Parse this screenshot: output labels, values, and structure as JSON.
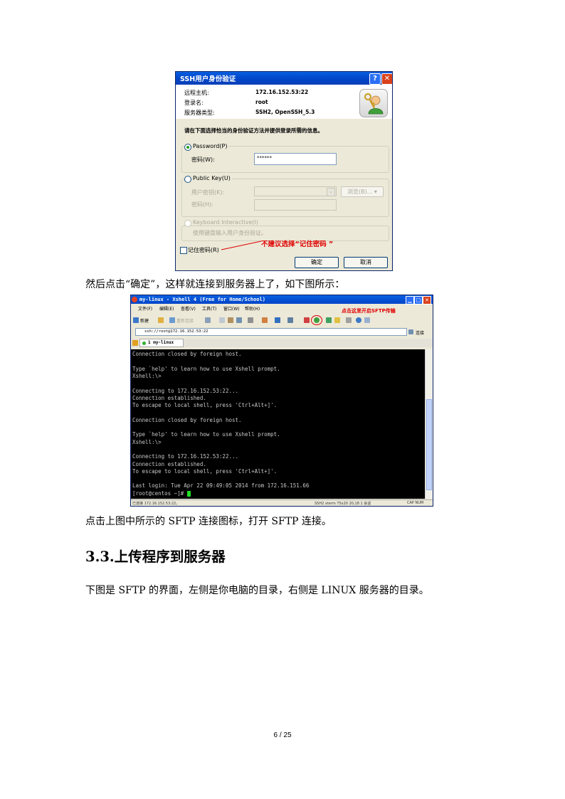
{
  "dialog": {
    "title": "SSH用户身份验证",
    "help": "?",
    "close": "✕",
    "info": [
      {
        "label": "远程主机:",
        "value": "172.16.152.53:22"
      },
      {
        "label": "登录名:",
        "value": "root"
      },
      {
        "label": "服务器类型:",
        "value": "SSH2, OpenSSH_5.3"
      }
    ],
    "instruction": "请在下面选择恰当的身份验证方法并提供登录所需的信息。",
    "password_option": "Password(P)",
    "password_label": "密码(W):",
    "password_value": "******",
    "publickey_option": "Public Key(U)",
    "user_key_label": "用户密钥(K):",
    "browse_button": "浏览(B)... ▾",
    "passphrase_label": "密码(H):",
    "keyboard_option": "Keyboard Interactive(I)",
    "keyboard_desc": "使用键盘输入用户身份验证。",
    "remember_password": "记住密码(R)",
    "annotation": "不建议选择“记住密码 ”",
    "ok_button": "确定",
    "cancel_button": "取消"
  },
  "para1": "然后点击“确定”，这样就连接到服务器上了，如下图所示：",
  "xshell": {
    "title": "my-linux - Xshell 4 (Free for Home/School)",
    "menu": [
      "文件(F)",
      "编辑(E)",
      "查看(V)",
      "工具(T)",
      "窗口(W)",
      "帮助(H)"
    ],
    "new_button": "新建",
    "reconnect": "重新连接",
    "address": "ssh://root@172.16.152.53:22",
    "connect_button": "连接",
    "annotation": "点击这里开启SFTP传输",
    "tab": "1 my-linux",
    "terminal_lines": [
      "Connection closed by foreign host.",
      "",
      "Type `help' to learn how to use Xshell prompt.",
      "Xshell:\\>",
      "",
      "Connecting to 172.16.152.53:22...",
      "Connection established.",
      "To escape to local shell, press 'Ctrl+Alt+]'.",
      "",
      "Connection closed by foreign host.",
      "",
      "Type `help' to learn how to use Xshell prompt.",
      "Xshell:\\>",
      "",
      "Connecting to 172.16.152.53:22...",
      "Connection established.",
      "To escape to local shell, press 'Ctrl+Alt+]'.",
      "",
      "Last login: Tue Apr 22 09:49:05 2014 from 172.16.151.66",
      "[root@centos ~]# "
    ],
    "status_left": "已连接 172.16.152.53:22。",
    "status_mid": "SSH2  xterm  75x20  20,18  1 会话",
    "status_right": "CAP  NUM"
  },
  "para2": "点击上图中所示的 SFTP 连接图标，打开 SFTP 连接。",
  "heading": "3.3.上传程序到服务器",
  "para3": "下图是 SFTP 的界面，左侧是你电脑的目录，右侧是 LINUX 服务器的目录。",
  "page_number": "6 / 25"
}
